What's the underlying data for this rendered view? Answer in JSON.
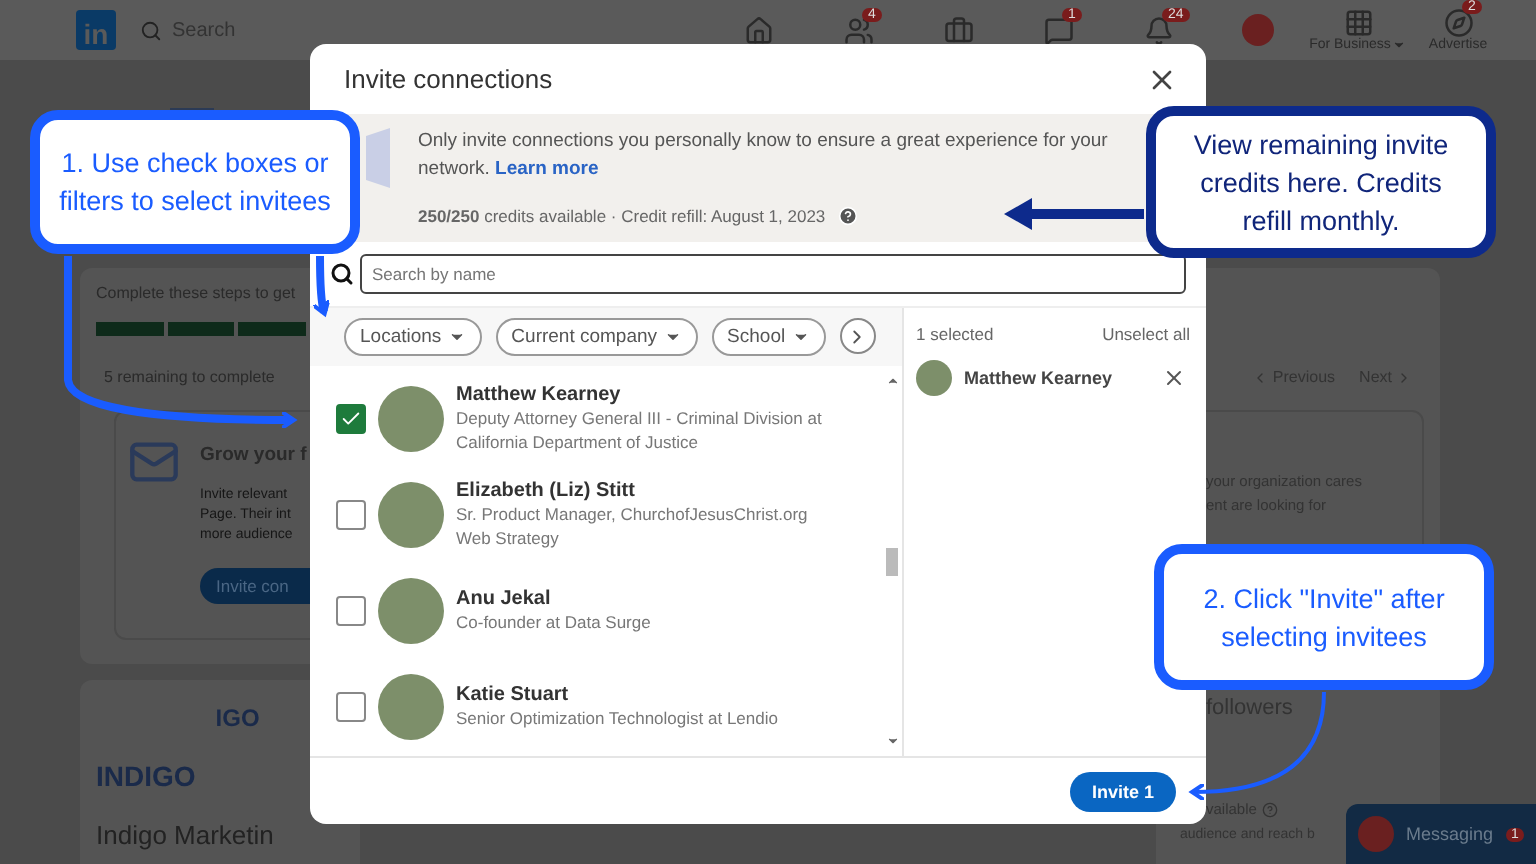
{
  "nav": {
    "logo": "in",
    "search_placeholder": "Search",
    "items": [
      {
        "kind": "home"
      },
      {
        "kind": "network",
        "badge": "4"
      },
      {
        "kind": "jobs"
      },
      {
        "kind": "messages",
        "badge": "1"
      },
      {
        "kind": "bell",
        "badge": "24"
      },
      {
        "kind": "avatar"
      },
      {
        "kind": "grid",
        "label": "For Business"
      },
      {
        "kind": "advertise",
        "label": "Advertise",
        "badge": "2"
      }
    ]
  },
  "page": {
    "steps_intro": "Complete these steps to get",
    "remaining": "5 remaining to complete",
    "task_title": "Grow your f",
    "task_lines": [
      "Invite relevant",
      "Page. Their int",
      "more audience"
    ],
    "task_button": "Invite con",
    "previous": "Previous",
    "next": "Next",
    "side_lines": [
      "your organization cares",
      "ent are looking for"
    ],
    "logo_word": "INDIGO",
    "logo_small": "IGO",
    "logo_name": "Indigo Marketin",
    "followers": "followers",
    "credits_hint": "vailable",
    "followers_text": "audience and reach b"
  },
  "messaging": {
    "label": "Messaging",
    "badge": "1"
  },
  "modal": {
    "title": "Invite connections",
    "notice": {
      "text": "Only invite connections you personally know to ensure a great experience for your network.",
      "link": "Learn more",
      "credits": "**250/250** credits available · Credit refill: August 1, 2023"
    },
    "search": {
      "placeholder": "Search by name"
    },
    "filters": [
      {
        "label": "Locations"
      },
      {
        "label": "Current company"
      },
      {
        "label": "School"
      }
    ],
    "selected_count": "1 selected",
    "unselect_all": "Unselect all",
    "people": [
      {
        "name": "Matthew Kearney",
        "headline": "Deputy Attorney General III - Criminal Division at California Department of Justice",
        "checked": true
      },
      {
        "name": "Elizabeth (Liz) Stitt",
        "headline": "Sr. Product Manager, ChurchofJesusChrist.org Web Strategy",
        "checked": false
      },
      {
        "name": "Anu Jekal",
        "headline": "Co-founder at Data Surge",
        "checked": false
      },
      {
        "name": "Katie Stuart",
        "headline": "Senior Optimization Technologist at Lendio",
        "checked": false
      }
    ],
    "selected": [
      {
        "name": "Matthew Kearney"
      }
    ],
    "invite_button": "Invite 1"
  },
  "callouts": [
    {
      "kind": "bright",
      "text": "1.  Use check boxes or filters to select invitees"
    },
    {
      "kind": "dark",
      "text": "View remaining invite credits here. Credits refill monthly."
    },
    {
      "kind": "bright",
      "text": "2. Click \"Invite\" after selecting invitees"
    }
  ]
}
